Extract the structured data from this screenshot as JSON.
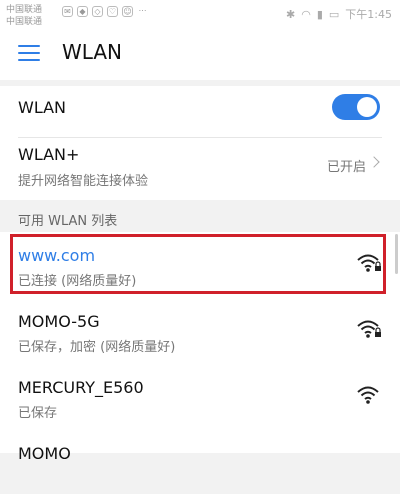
{
  "status_bar": {
    "carrier_1": "中国联通",
    "carrier_2": "中国联通",
    "time": "下午1:45"
  },
  "app_bar": {
    "title": "WLAN"
  },
  "wlan_toggle": {
    "label": "WLAN",
    "enabled": true
  },
  "wlan_plus": {
    "title": "WLAN+",
    "subtitle": "提升网络智能连接体验",
    "status": "已开启"
  },
  "section": {
    "title": "可用 WLAN 列表"
  },
  "networks": [
    {
      "name": "www.com",
      "status": "已连接 (网络质量好)",
      "connected": true,
      "locked": true
    },
    {
      "name": "MOMO-5G",
      "status": "已保存，加密 (网络质量好)",
      "connected": false,
      "locked": true
    },
    {
      "name": "MERCURY_E560",
      "status": "已保存",
      "connected": false,
      "locked": false
    },
    {
      "name": "MOMO",
      "status": "",
      "connected": false,
      "locked": false
    }
  ],
  "colors": {
    "accent": "#2f7ee6",
    "highlight": "#d0202a"
  }
}
